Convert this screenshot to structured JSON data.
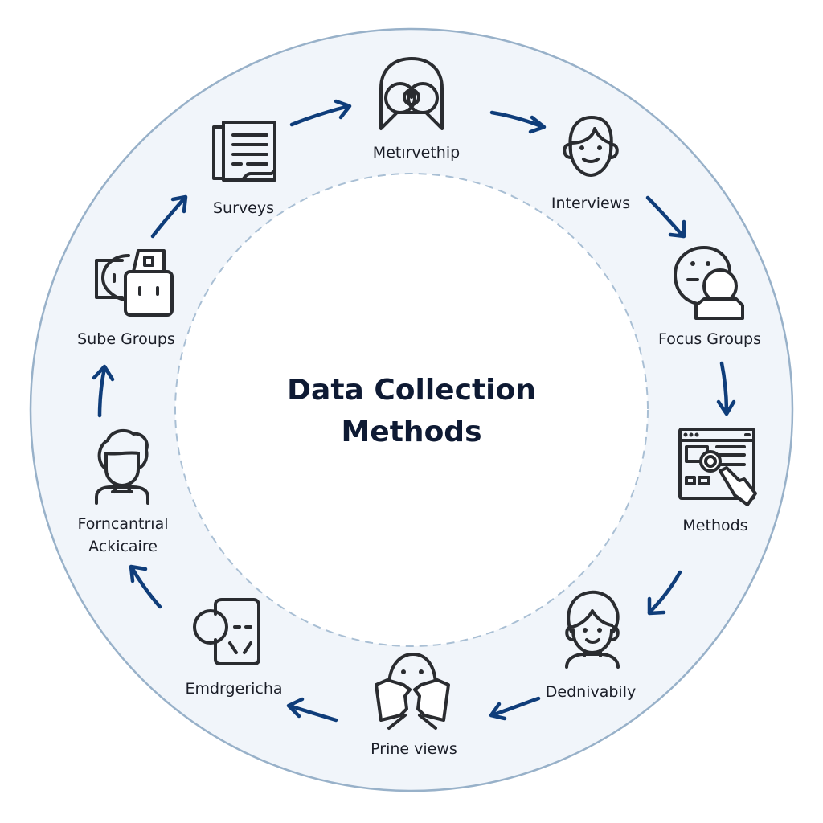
{
  "title": {
    "line1": "Data Collection",
    "line2": "Methods"
  },
  "colors": {
    "ring_fill": "#f1f5fa",
    "ring_stroke": "#98b1c9",
    "inner_fill": "#ffffff",
    "inner_dash": "#a9bfd4",
    "arrow": "#0f3d7a",
    "icon_stroke": "#2a2c30",
    "label_text": "#1b1e28",
    "title_text": "#0e1a33"
  },
  "nodes": [
    {
      "id": "metirvethip",
      "label": "Metırvethip",
      "icon": "hooded-face-icon"
    },
    {
      "id": "interviews",
      "label": "Interviews",
      "icon": "person-face-icon"
    },
    {
      "id": "focus-groups",
      "label": "Focus Groups",
      "icon": "group-faces-icon"
    },
    {
      "id": "methods",
      "label": "Methods",
      "icon": "browser-magnifier-hand-icon"
    },
    {
      "id": "dednivabily",
      "label": "Dednivabily",
      "icon": "curly-hair-person-icon"
    },
    {
      "id": "prine-views",
      "label": "Prine views",
      "icon": "ghost-book-icon"
    },
    {
      "id": "emdrgericha",
      "label": "Emdrgericha",
      "icon": "card-circle-icon"
    },
    {
      "id": "forncantrial-ackicaire",
      "label_line1": "Forncantrıal",
      "label_line2": "Ackicaire",
      "icon": "person-bust-icon"
    },
    {
      "id": "sube-groups",
      "label": "Sube Groups",
      "icon": "robot-faces-icon"
    },
    {
      "id": "surveys",
      "label": "Surveys",
      "icon": "document-lines-icon"
    }
  ],
  "flow_direction": "clockwise"
}
